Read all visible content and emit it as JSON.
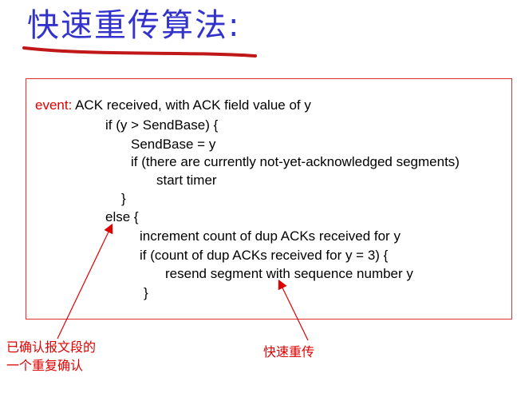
{
  "title": "快速重传算法:",
  "colors": {
    "title": "#3333cc",
    "accent_red": "#e00000",
    "box_border": "#e03030"
  },
  "pseudocode": {
    "event_keyword": "event:",
    "event_text": " ACK received, with ACK field value of y",
    "lines": [
      "if (y > SendBase) {",
      "SendBase = y",
      "if (there are currently not-yet-acknowledged segments)",
      "start timer",
      "}",
      "else {",
      "increment count of dup ACKs received for y",
      "if (count of dup ACKs received for y = 3) {",
      "resend segment with sequence number y",
      "}"
    ]
  },
  "annotations": {
    "dup_ack_line1": "已确认报文段的",
    "dup_ack_line2": "一个重复确认",
    "fast_retransmit": "快速重传"
  }
}
